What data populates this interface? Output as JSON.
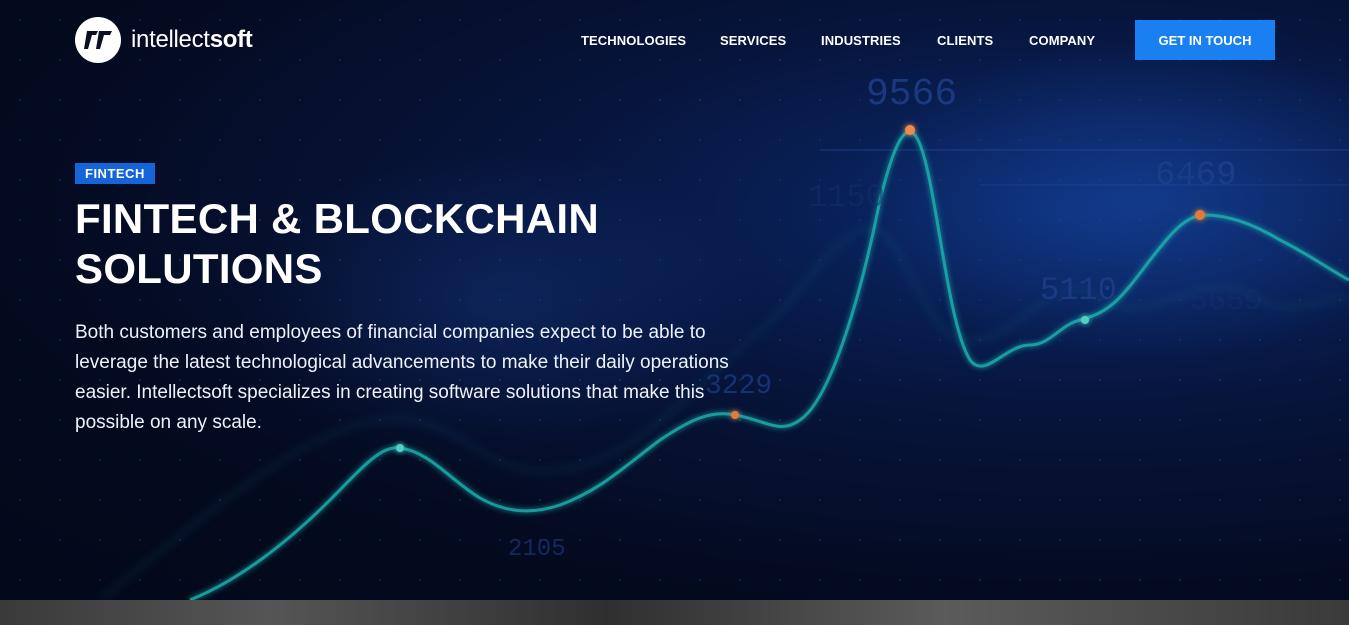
{
  "header": {
    "logo": {
      "name_light": "intellect",
      "name_bold": "soft",
      "mark_icon": "intellectsoft-logo-icon"
    },
    "nav": [
      {
        "label": "TECHNOLOGIES"
      },
      {
        "label": "SERVICES"
      },
      {
        "label": "INDUSTRIES"
      },
      {
        "label": "CLIENTS"
      },
      {
        "label": "COMPANY"
      }
    ],
    "cta_label": "GET IN TOUCH"
  },
  "hero": {
    "tag": "FINTECH",
    "title": "FINTECH & BLOCKCHAIN SOLUTIONS",
    "description": "Both customers and employees of financial companies expect to be able to leverage the latest technological advancements to make their daily operations easier. Intellectsoft specializes in creating software solutions that make this possible on any scale.",
    "background_numbers": [
      "9566",
      "6469",
      "1150",
      "5110",
      "5659",
      "3229",
      "2105"
    ]
  },
  "colors": {
    "accent": "#1a7ff0",
    "tag_bg": "#1565d8",
    "graph_line": "#1fb5b0"
  }
}
